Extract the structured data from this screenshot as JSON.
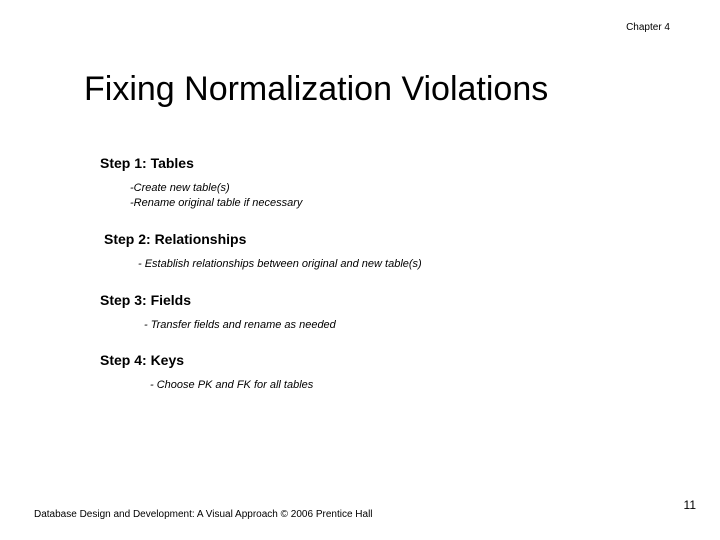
{
  "chapter": "Chapter 4",
  "title": "Fixing Normalization Violations",
  "steps": {
    "s1_header": "Step 1: Tables",
    "s1_line1": "-Create new table(s)",
    "s1_line2": "-Rename original table if necessary",
    "s2_header": "Step 2: Relationships",
    "s2_line1": "- Establish relationships between original and new table(s)",
    "s3_header": "Step 3: Fields",
    "s3_line1": "- Transfer fields and rename as needed",
    "s4_header": "Step 4: Keys",
    "s4_line1": "- Choose PK and FK for all tables"
  },
  "footer": {
    "left": "Database Design and Development: A Visual Approach   © 2006 Prentice Hall",
    "page": "11"
  }
}
